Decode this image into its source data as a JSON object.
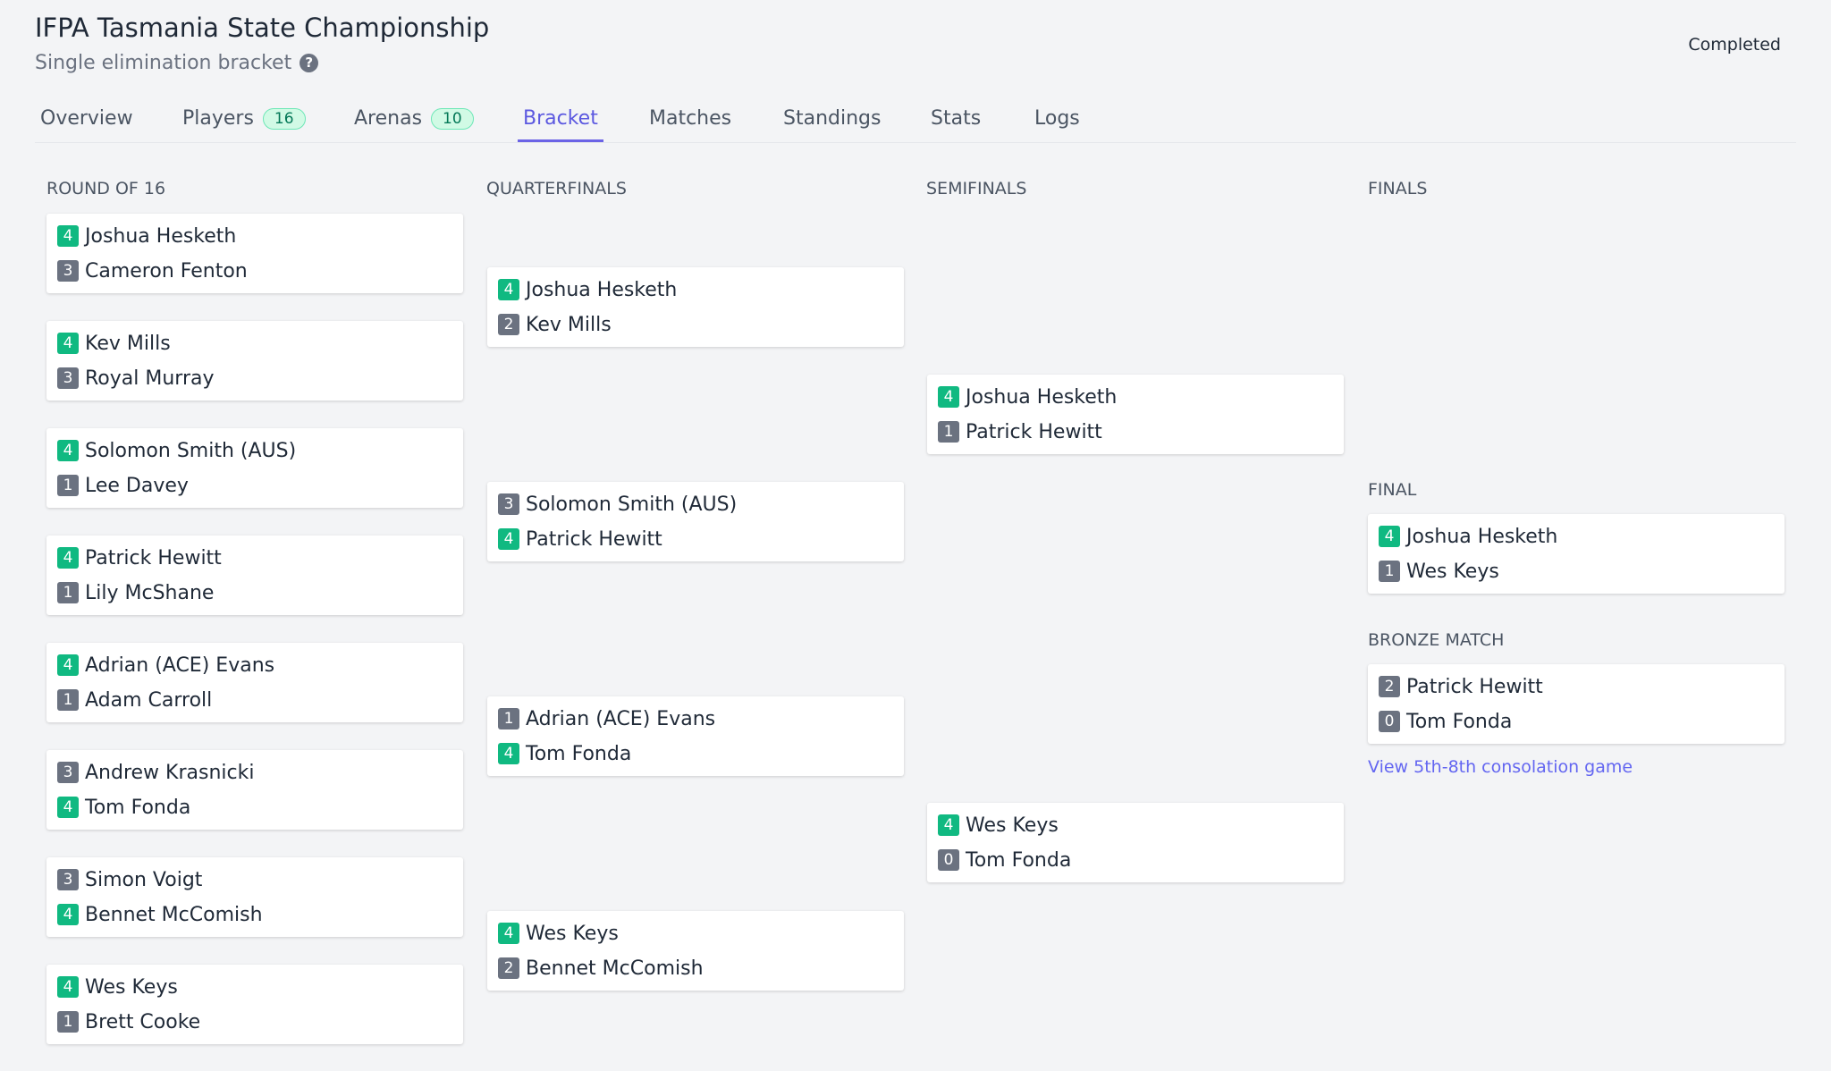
{
  "header": {
    "title": "IFPA Tasmania State Championship",
    "subtitle": "Single elimination bracket",
    "help_icon": "?",
    "status": "Completed"
  },
  "tabs": [
    {
      "label": "Overview"
    },
    {
      "label": "Players",
      "count": "16"
    },
    {
      "label": "Arenas",
      "count": "10"
    },
    {
      "label": "Bracket"
    },
    {
      "label": "Matches"
    },
    {
      "label": "Standings"
    },
    {
      "label": "Stats"
    },
    {
      "label": "Logs"
    }
  ],
  "active_tab": "Bracket",
  "rounds": [
    {
      "name": "ROUND OF 16",
      "matches": [
        {
          "p1": {
            "name": "Joshua Hesketh",
            "score": "4",
            "win": true
          },
          "p2": {
            "name": "Cameron Fenton",
            "score": "3",
            "win": false
          }
        },
        {
          "p1": {
            "name": "Kev Mills",
            "score": "4",
            "win": true
          },
          "p2": {
            "name": "Royal Murray",
            "score": "3",
            "win": false
          }
        },
        {
          "p1": {
            "name": "Solomon Smith (AUS)",
            "score": "4",
            "win": true
          },
          "p2": {
            "name": "Lee Davey",
            "score": "1",
            "win": false
          }
        },
        {
          "p1": {
            "name": "Patrick Hewitt",
            "score": "4",
            "win": true
          },
          "p2": {
            "name": "Lily McShane",
            "score": "1",
            "win": false
          }
        },
        {
          "p1": {
            "name": "Adrian (ACE) Evans",
            "score": "4",
            "win": true
          },
          "p2": {
            "name": "Adam Carroll",
            "score": "1",
            "win": false
          }
        },
        {
          "p1": {
            "name": "Andrew Krasnicki",
            "score": "3",
            "win": false
          },
          "p2": {
            "name": "Tom Fonda",
            "score": "4",
            "win": true
          }
        },
        {
          "p1": {
            "name": "Simon Voigt",
            "score": "3",
            "win": false
          },
          "p2": {
            "name": "Bennet McComish",
            "score": "4",
            "win": true
          }
        },
        {
          "p1": {
            "name": "Wes Keys",
            "score": "4",
            "win": true
          },
          "p2": {
            "name": "Brett Cooke",
            "score": "1",
            "win": false
          }
        }
      ]
    },
    {
      "name": "QUARTERFINALS",
      "matches": [
        {
          "p1": {
            "name": "Joshua Hesketh",
            "score": "4",
            "win": true
          },
          "p2": {
            "name": "Kev Mills",
            "score": "2",
            "win": false
          }
        },
        {
          "p1": {
            "name": "Solomon Smith (AUS)",
            "score": "3",
            "win": false
          },
          "p2": {
            "name": "Patrick Hewitt",
            "score": "4",
            "win": true
          }
        },
        {
          "p1": {
            "name": "Adrian (ACE) Evans",
            "score": "1",
            "win": false
          },
          "p2": {
            "name": "Tom Fonda",
            "score": "4",
            "win": true
          }
        },
        {
          "p1": {
            "name": "Wes Keys",
            "score": "4",
            "win": true
          },
          "p2": {
            "name": "Bennet McComish",
            "score": "2",
            "win": false
          }
        }
      ]
    },
    {
      "name": "SEMIFINALS",
      "matches": [
        {
          "p1": {
            "name": "Joshua Hesketh",
            "score": "4",
            "win": true
          },
          "p2": {
            "name": "Patrick Hewitt",
            "score": "1",
            "win": false
          }
        },
        {
          "p1": {
            "name": "Wes Keys",
            "score": "4",
            "win": true
          },
          "p2": {
            "name": "Tom Fonda",
            "score": "0",
            "win": false
          }
        }
      ]
    },
    {
      "name": "FINALS",
      "sections": [
        {
          "label": "FINAL",
          "match": {
            "p1": {
              "name": "Joshua Hesketh",
              "score": "4",
              "win": true
            },
            "p2": {
              "name": "Wes Keys",
              "score": "1",
              "win": false
            }
          }
        },
        {
          "label": "BRONZE MATCH",
          "match": {
            "p1": {
              "name": "Patrick Hewitt",
              "score": "2",
              "win": false
            },
            "p2": {
              "name": "Tom Fonda",
              "score": "0",
              "win": false
            }
          }
        }
      ]
    }
  ],
  "consolation_link": "View 5th-8th consolation game"
}
